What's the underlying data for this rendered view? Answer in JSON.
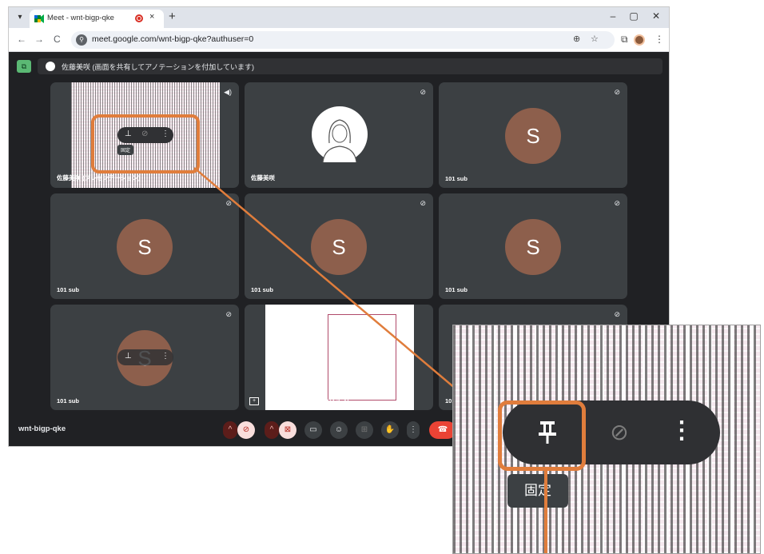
{
  "browser": {
    "tab_title": "Meet - wnt-bigp-qke",
    "tab_close": "×",
    "new_tab": "+",
    "url": "meet.google.com/wnt-bigp-qke?authuser=0",
    "window_controls": [
      "–",
      "▢",
      "✕"
    ],
    "nav": [
      "←",
      "→",
      "C"
    ]
  },
  "meet": {
    "banner_text": "佐藤美咲 (画面を共有してアノテーションを付加しています)",
    "meeting_code": "wnt-bigp-qke",
    "tiles": [
      {
        "name": "佐藤美咲 (プレゼンテーション)",
        "type": "doc"
      },
      {
        "name": "佐藤美咲",
        "type": "photo"
      },
      {
        "name": "101 sub",
        "type": "avatar",
        "initial": "S"
      },
      {
        "name": "101 sub",
        "type": "avatar",
        "initial": "S"
      },
      {
        "name": "101 sub",
        "type": "avatar",
        "initial": "S"
      },
      {
        "name": "101 sub",
        "type": "avatar",
        "initial": "S"
      },
      {
        "name": "101 sub",
        "type": "avatar",
        "initial": "S"
      },
      {
        "name": "佐藤美咲 (プレゼンテーション)",
        "type": "doc"
      },
      {
        "name": "101 sub",
        "type": "avatar",
        "initial": "S"
      }
    ],
    "pin_tooltip": "固定"
  },
  "zoom": {
    "pin_tooltip": "固定"
  },
  "colors": {
    "highlight": "#e07d3c",
    "avatar": "#8d5f4c",
    "meet_bg": "#202124",
    "tile_bg": "#3c4043"
  }
}
